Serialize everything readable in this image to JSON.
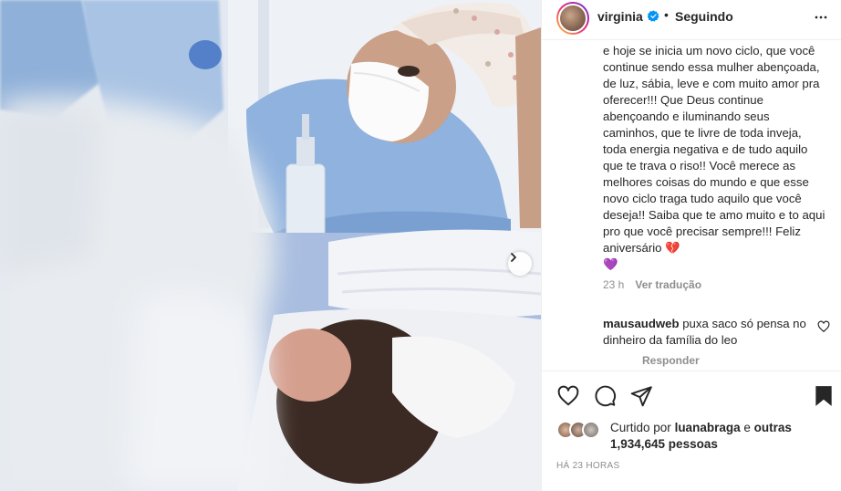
{
  "post": {
    "username": "virginia",
    "separator": "•",
    "follow_status": "Seguindo"
  },
  "caption": {
    "text": "e hoje se inicia um novo ciclo, que você continue sendo essa mulher abençoada, de luz, sábia, leve e com muito amor pra oferecer!!! Que Deus continue abençoando e iluminando seus caminhos, que te livre de toda inveja, toda energia negativa e de tudo aquilo que te trava o riso!! Você merece as melhores coisas do mundo e que esse novo ciclo traga tudo aquilo que você deseja!! Saiba que te amo muito e to aqui pro que você precisar sempre!!! Feliz aniversário",
    "emoji_1": "💔",
    "emoji_2": "💜",
    "age": "23 h",
    "see_translation": "Ver tradução"
  },
  "comment": {
    "user": "mausaudweb",
    "text": "puxa saco só pensa no dinheiro da família do leo",
    "reply_label": "Responder"
  },
  "likes": {
    "prefix": "Curtido por",
    "liked_by": "luanabraga",
    "conjunction": "e",
    "others": "outras 1,934,645 pessoas"
  },
  "timestamp": "HÁ 23 HORAS",
  "icons": {
    "verified": "verified-badge-icon",
    "more": "more-options-icon",
    "like": "heart-icon",
    "comment": "comment-icon",
    "share": "paper-plane-icon",
    "save": "bookmark-icon",
    "next": "chevron-right-icon"
  },
  "colors": {
    "verified_blue": "#0095f6",
    "text_primary": "#262626",
    "text_secondary": "#8e8e8e"
  }
}
